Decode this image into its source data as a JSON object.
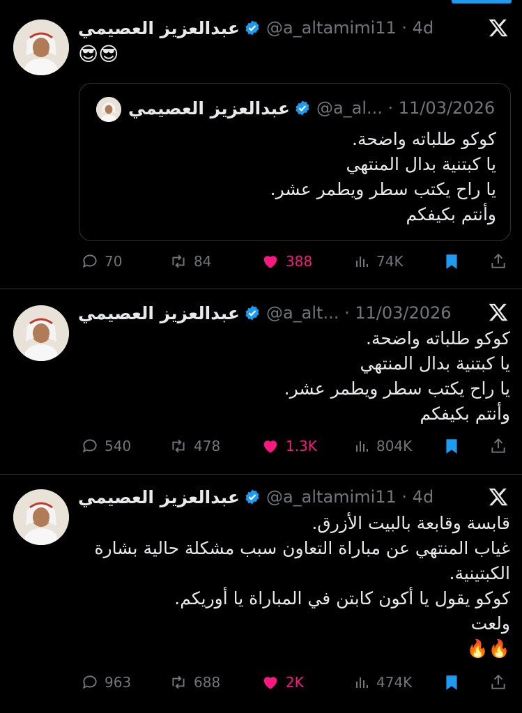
{
  "colors": {
    "background": "#000000",
    "text": "#e7e9ea",
    "muted": "#71767b",
    "verified": "#1d9bf0",
    "like": "#f91880",
    "bookmark": "#1d9bf0"
  },
  "tweets": [
    {
      "name": "عبدالعزيز العصيمي",
      "handle": "@a_altamimi11 · 4d",
      "text": "😎😎",
      "quote": {
        "name": "عبدالعزيز العصيمي",
        "handle": "@a_al... · 11/03/2026",
        "text": "كوكو طلباته واضحة.\nيا كبتنية بدال المنتهي\nيا راح يكتب سطر ويطمر عشر.\nوأنتم بكيفكم"
      },
      "stats": {
        "replies": "70",
        "reposts": "84",
        "likes": "388",
        "views": "74K"
      }
    },
    {
      "name": "عبدالعزيز العصيمي",
      "handle": "@a_alt... · 11/03/2026",
      "text": "كوكو طلباته واضحة.\nيا كبتنية بدال المنتهي\nيا راح يكتب سطر ويطمر عشر.\nوأنتم بكيفكم",
      "stats": {
        "replies": "540",
        "reposts": "478",
        "likes": "1.3K",
        "views": "804K"
      }
    },
    {
      "name": "عبدالعزيز العصيمي",
      "handle": "@a_altamimi11 · 4d",
      "text": "قابسة وقابعة بالبيت الأزرق.\nغياب المنتهي عن مباراة التعاون سبب مشكلة حالية بشارة الكبتينية.\nكوكو يقول يا أكون كابتن في المباراة يا أوريكم.\nولعت\n🔥🔥",
      "stats": {
        "replies": "963",
        "reposts": "688",
        "likes": "2K",
        "views": "474K"
      }
    }
  ]
}
